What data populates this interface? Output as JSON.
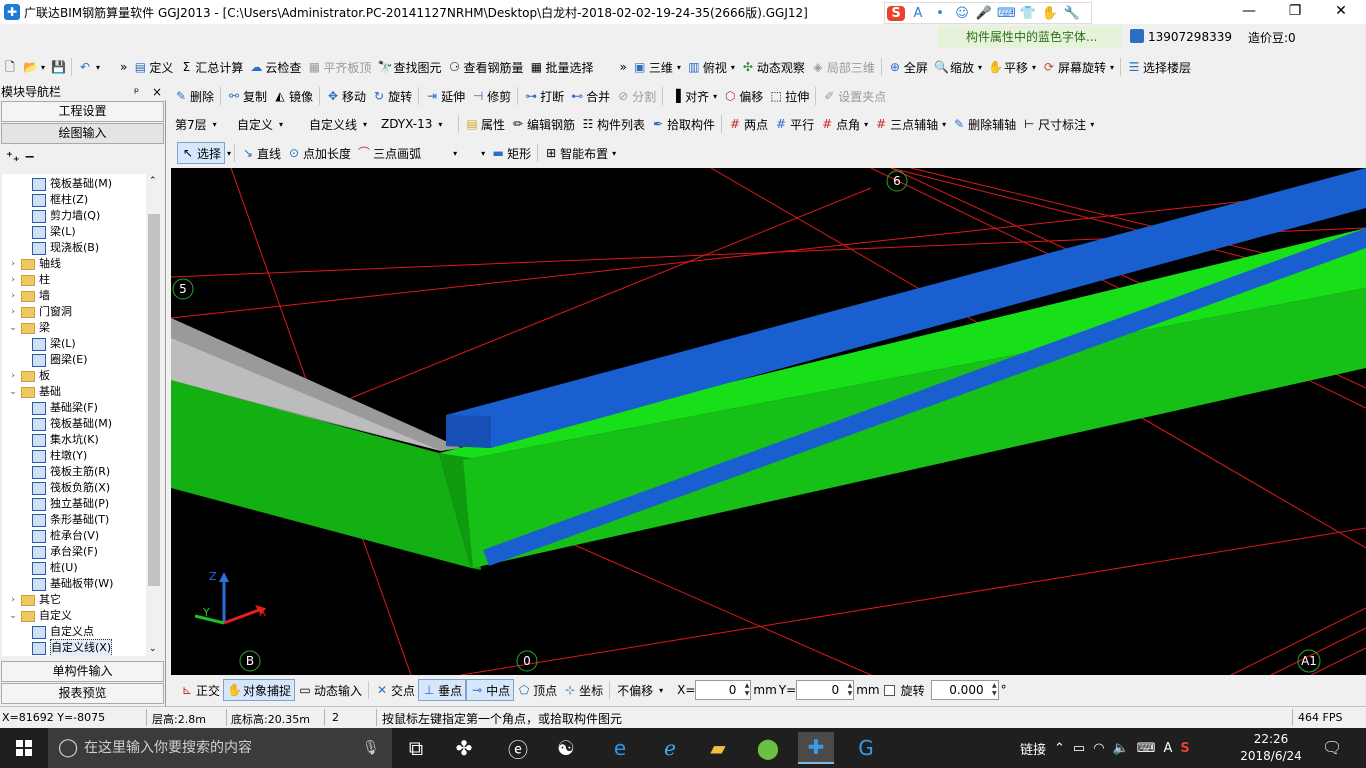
{
  "window": {
    "title": "广联达BIM钢筋算量软件 GGJ2013 - [C:\\Users\\Administrator.PC-20141127NRHM\\Desktop\\白龙村-2018-02-02-19-24-35(2666版).GGJ12]",
    "minimize": "—",
    "maximize": "❐",
    "close": "✕"
  },
  "ime": {
    "logo": "S",
    "items": [
      "A",
      "•",
      "☺",
      "🎤",
      "⌨",
      "👕",
      "✋",
      "🔧"
    ]
  },
  "header": {
    "hint": "构件属性中的蓝色字体...",
    "phone": "13907298339",
    "beans": "造价豆:0"
  },
  "toolbar1": {
    "define": "定义",
    "summary": "汇总计算",
    "cloud_check": "云检查",
    "align_slab": "平齐板顶",
    "find": "查找图元",
    "view_rebar": "查看钢筋量",
    "batch_select": "批量选择",
    "three_d": "三维",
    "top_view": "俯视",
    "dynamic_view": "动态观察",
    "local_3d": "局部三维",
    "fullscreen": "全屏",
    "zoom": "缩放",
    "pan": "平移",
    "screen_rotate": "屏幕旋转",
    "select_floor": "选择楼层"
  },
  "toolbar2": {
    "delete": "删除",
    "copy": "复制",
    "mirror": "镜像",
    "move": "移动",
    "rotate": "旋转",
    "extend": "延伸",
    "trim": "修剪",
    "break": "打断",
    "merge": "合并",
    "split": "分割",
    "align": "对齐",
    "offset": "偏移",
    "stretch": "拉伸",
    "set_clamp": "设置夹点"
  },
  "toolbar3": {
    "floor": "第7层",
    "category": "自定义",
    "type": "自定义线",
    "component": "ZDYX-13",
    "properties": "属性",
    "edit_rebar": "编辑钢筋",
    "component_list": "构件列表",
    "pick": "拾取构件",
    "two_points": "两点",
    "parallel": "平行",
    "point_angle": "点角",
    "three_point_axis": "三点辅轴",
    "delete_axis": "删除辅轴",
    "dimension": "尺寸标注"
  },
  "toolbar4": {
    "select": "选择",
    "line": "直线",
    "point_length": "点加长度",
    "arc": "三点画弧",
    "rect": "矩形",
    "smart_layout": "智能布置"
  },
  "left_panel": {
    "title": "模块导航栏",
    "pin": "ᵖ",
    "close": "×",
    "project_settings": "工程设置",
    "drawing_input": "绘图输入",
    "single_input": "单构件输入",
    "report_preview": "报表预览",
    "tree": [
      {
        "label": "筏板基础(M)",
        "level": 2,
        "kind": "item"
      },
      {
        "label": "框柱(Z)",
        "level": 2,
        "kind": "item"
      },
      {
        "label": "剪力墙(Q)",
        "level": 2,
        "kind": "item"
      },
      {
        "label": "梁(L)",
        "level": 2,
        "kind": "item"
      },
      {
        "label": "现浇板(B)",
        "level": 2,
        "kind": "item"
      },
      {
        "label": "轴线",
        "level": 1,
        "kind": "folder",
        "exp": "›"
      },
      {
        "label": "柱",
        "level": 1,
        "kind": "folder",
        "exp": "›"
      },
      {
        "label": "墙",
        "level": 1,
        "kind": "folder",
        "exp": "›"
      },
      {
        "label": "门窗洞",
        "level": 1,
        "kind": "folder",
        "exp": "›"
      },
      {
        "label": "梁",
        "level": 1,
        "kind": "folder",
        "exp": "⌄"
      },
      {
        "label": "梁(L)",
        "level": 2,
        "kind": "item"
      },
      {
        "label": "圈梁(E)",
        "level": 2,
        "kind": "item"
      },
      {
        "label": "板",
        "level": 1,
        "kind": "folder",
        "exp": "›"
      },
      {
        "label": "基础",
        "level": 1,
        "kind": "folder",
        "exp": "⌄"
      },
      {
        "label": "基础梁(F)",
        "level": 2,
        "kind": "item"
      },
      {
        "label": "筏板基础(M)",
        "level": 2,
        "kind": "item"
      },
      {
        "label": "集水坑(K)",
        "level": 2,
        "kind": "item"
      },
      {
        "label": "柱墩(Y)",
        "level": 2,
        "kind": "item"
      },
      {
        "label": "筏板主筋(R)",
        "level": 2,
        "kind": "item"
      },
      {
        "label": "筏板负筋(X)",
        "level": 2,
        "kind": "item"
      },
      {
        "label": "独立基础(P)",
        "level": 2,
        "kind": "item"
      },
      {
        "label": "条形基础(T)",
        "level": 2,
        "kind": "item"
      },
      {
        "label": "桩承台(V)",
        "level": 2,
        "kind": "item"
      },
      {
        "label": "承台梁(F)",
        "level": 2,
        "kind": "item"
      },
      {
        "label": "桩(U)",
        "level": 2,
        "kind": "item"
      },
      {
        "label": "基础板带(W)",
        "level": 2,
        "kind": "item"
      },
      {
        "label": "其它",
        "level": 1,
        "kind": "folder",
        "exp": "›"
      },
      {
        "label": "自定义",
        "level": 1,
        "kind": "folder",
        "exp": "⌄"
      },
      {
        "label": "自定义点",
        "level": 2,
        "kind": "item"
      },
      {
        "label": "自定义线(X)",
        "level": 2,
        "kind": "item",
        "selected": true
      }
    ]
  },
  "viewport": {
    "axis_labels": [
      "6",
      "5",
      "B",
      "0",
      "A1"
    ],
    "colors": {
      "background": "#000000",
      "blue_beam": "#1a5fd0",
      "green_beam": "#18c818",
      "grid": "#e01818",
      "gray_slab": "#b8b8b8"
    }
  },
  "snapbar": {
    "ortho": "正交",
    "snap": "对象捕捉",
    "dynamic_input": "动态输入",
    "intersection": "交点",
    "perpendicular": "垂点",
    "midpoint": "中点",
    "vertex": "顶点",
    "coordinate": "坐标",
    "offset_mode": "不偏移",
    "x_label": "X=",
    "x_value": "0",
    "y_label": "Y=",
    "y_value": "0",
    "unit": "mm",
    "rotate_label": "旋转",
    "rotate_value": "0.000",
    "degree": "°"
  },
  "status": {
    "coords": "X=81692 Y=-8075",
    "floor_height": "层高:2.8m",
    "base_height": "底标高:20.35m",
    "count": "2",
    "message": "按鼠标左键指定第一个角点，或拾取构件图元",
    "fps": "464 FPS"
  },
  "taskbar": {
    "search_placeholder": "在这里输入你要搜索的内容",
    "tray_link": "链接",
    "ime_mode": "A",
    "time": "22:26",
    "date": "2018/6/24"
  }
}
